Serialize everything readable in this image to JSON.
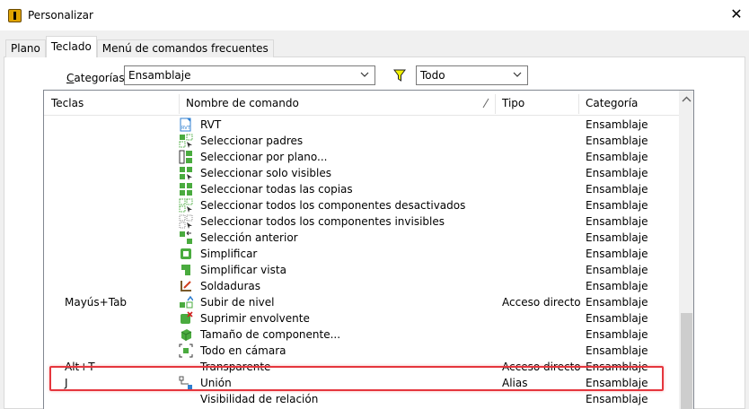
{
  "window": {
    "title": "Personalizar",
    "close_glyph": "✕"
  },
  "tabs": [
    {
      "label": "Plano",
      "active": false
    },
    {
      "label": "Teclado",
      "active": true
    },
    {
      "label": "Menú de comandos frecuentes",
      "active": false
    }
  ],
  "filters": {
    "category_label_prefix": "C",
    "category_label_rest": "ategorías",
    "category_value": "Ensamblaje",
    "filter_value": "Todo",
    "filter_icon_color": "#e8e800"
  },
  "table": {
    "columns": [
      "Teclas",
      "Nombre de comando",
      "Tipo",
      "Categoría"
    ],
    "sort_glyph": "╱",
    "rows": [
      {
        "key": "",
        "icon": "rvt-icon",
        "name": "RVT",
        "type": "",
        "category": "Ensamblaje"
      },
      {
        "key": "",
        "icon": "select-parents-icon",
        "name": "Seleccionar padres",
        "type": "",
        "category": "Ensamblaje"
      },
      {
        "key": "",
        "icon": "select-by-plane-icon",
        "name": "Seleccionar por plano...",
        "type": "",
        "category": "Ensamblaje"
      },
      {
        "key": "",
        "icon": "select-visible-icon",
        "name": "Seleccionar solo visibles",
        "type": "",
        "category": "Ensamblaje"
      },
      {
        "key": "",
        "icon": "select-all-copies-icon",
        "name": "Seleccionar todas las copias",
        "type": "",
        "category": "Ensamblaje"
      },
      {
        "key": "",
        "icon": "select-suppressed-icon",
        "name": "Seleccionar todos los componentes desactivados",
        "type": "",
        "category": "Ensamblaje"
      },
      {
        "key": "",
        "icon": "select-invisible-icon",
        "name": "Seleccionar todos los componentes invisibles",
        "type": "",
        "category": "Ensamblaje"
      },
      {
        "key": "",
        "icon": "previous-selection-icon",
        "name": "Selección anterior",
        "type": "",
        "category": "Ensamblaje"
      },
      {
        "key": "",
        "icon": "simplify-icon",
        "name": "Simplificar",
        "type": "",
        "category": "Ensamblaje"
      },
      {
        "key": "",
        "icon": "simplify-view-icon",
        "name": "Simplificar vista",
        "type": "",
        "category": "Ensamblaje"
      },
      {
        "key": "",
        "icon": "weldments-icon",
        "name": "Soldaduras",
        "type": "",
        "category": "Ensamblaje"
      },
      {
        "key": "Mayús+Tab",
        "icon": "level-up-icon",
        "name": "Subir de nivel",
        "type": "Acceso directo",
        "category": "Ensamblaje"
      },
      {
        "key": "",
        "icon": "suppress-envelope-icon",
        "name": "Suprimir envolvente",
        "type": "",
        "category": "Ensamblaje"
      },
      {
        "key": "",
        "icon": "component-size-icon",
        "name": "Tamaño de componente...",
        "type": "",
        "category": "Ensamblaje"
      },
      {
        "key": "",
        "icon": "all-in-camera-icon",
        "name": "Todo en cámara",
        "type": "",
        "category": "Ensamblaje"
      },
      {
        "key": "Alt+T",
        "icon": "",
        "name": "Transparente",
        "type": "Acceso directo",
        "category": "Ensamblaje"
      },
      {
        "key": "J",
        "icon": "join-icon",
        "name": "Unión",
        "type": "Alias",
        "category": "Ensamblaje"
      },
      {
        "key": "",
        "icon": "",
        "name": "Visibilidad de relación",
        "type": "",
        "category": "Ensamblaje"
      }
    ]
  },
  "colors": {
    "highlight": "#e5363d",
    "icon_green": "#4aab3f",
    "icon_blue": "#2f7fd0"
  }
}
